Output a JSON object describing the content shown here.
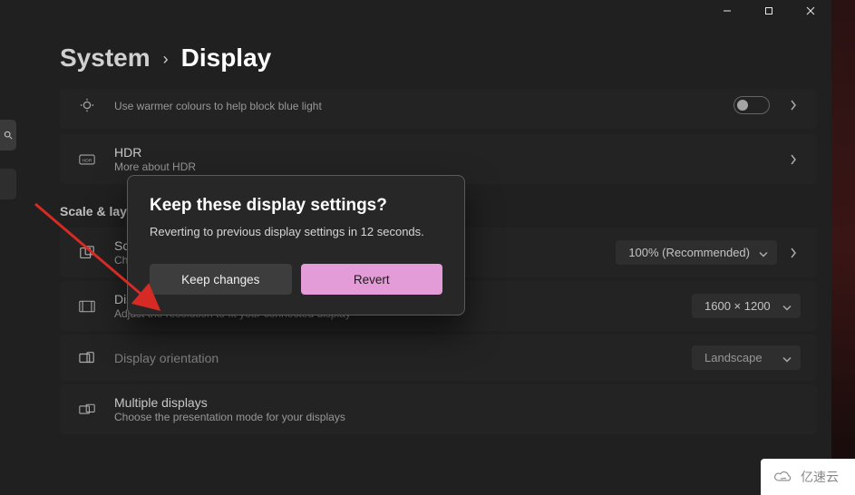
{
  "window": {
    "minimize_tooltip": "Minimize",
    "maximize_tooltip": "Maximize",
    "close_tooltip": "Close"
  },
  "breadcrumb": {
    "root": "System",
    "separator": "›",
    "page": "Display"
  },
  "sections": {
    "scale_layout": "Scale & layout"
  },
  "cards": {
    "night_light": {
      "title": "",
      "subtitle": "Use warmer colours to help block blue light"
    },
    "hdr": {
      "title": "HDR",
      "subtitle": "More about HDR"
    },
    "scale": {
      "title": "Scale",
      "subtitle": "Change the size of text, apps and other items",
      "value": "100% (Recommended)"
    },
    "resolution": {
      "title": "Display resolution",
      "subtitle": "Adjust the resolution to fit your connected display",
      "value": "1600 × 1200"
    },
    "orientation": {
      "title": "Display orientation",
      "value": "Landscape"
    },
    "multiple": {
      "title": "Multiple displays",
      "subtitle": "Choose the presentation mode for your displays"
    }
  },
  "modal": {
    "title": "Keep these display settings?",
    "message": "Reverting to previous display settings in 12 seconds.",
    "keep_label": "Keep changes",
    "revert_label": "Revert"
  },
  "watermark": {
    "text": "亿速云"
  },
  "colors": {
    "accent": "#e49cd8",
    "annotation_arrow": "#d62a24"
  }
}
